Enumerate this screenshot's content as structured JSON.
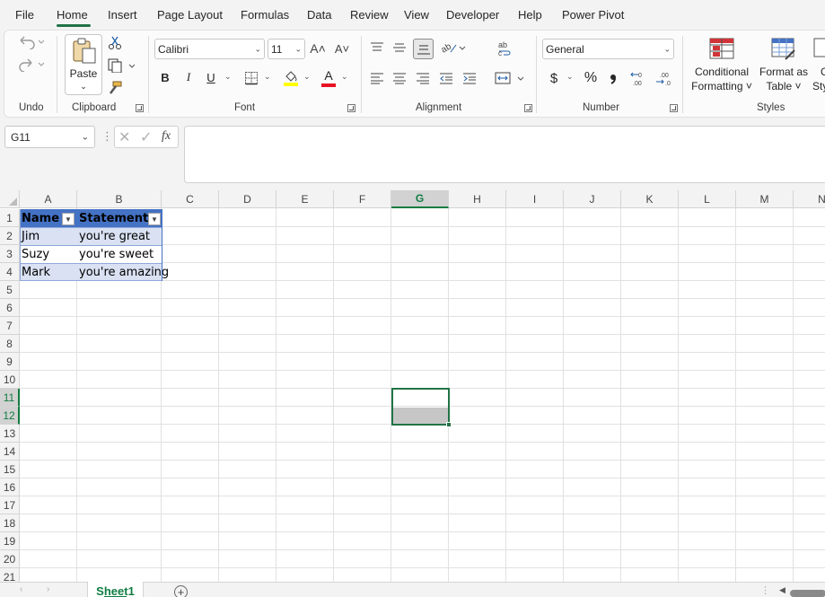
{
  "menu": {
    "tabs": [
      "File",
      "Home",
      "Insert",
      "Page Layout",
      "Formulas",
      "Data",
      "Review",
      "View",
      "Developer",
      "Help",
      "Power Pivot"
    ],
    "active": "Home"
  },
  "ribbon": {
    "groups": {
      "undo": "Undo",
      "clipboard": "Clipboard",
      "font": "Font",
      "alignment": "Alignment",
      "number": "Number",
      "styles": "Styles"
    },
    "paste_label": "Paste",
    "font_name": "Calibri",
    "font_size": "11",
    "grow_font": "A˄",
    "shrink_font": "A˅",
    "bold": "B",
    "italic": "I",
    "underline": "U",
    "font_color_glyph": "A",
    "number_format": "General",
    "currency": "$",
    "percent": "%",
    "comma": "9",
    "conditional_formatting": [
      "Conditional",
      "Formatting ˅"
    ],
    "format_as_table": [
      "Format as",
      "Table ˅"
    ],
    "cell_styles_partial": [
      "C",
      "Sty"
    ],
    "colors": {
      "fill_swatch": "#ffff00",
      "font_swatch": "#e81123",
      "accent": "#217346"
    }
  },
  "formula_bar": {
    "name_box": "G11",
    "fx": "fx",
    "content": ""
  },
  "sheet": {
    "columns": [
      "A",
      "B",
      "C",
      "D",
      "E",
      "F",
      "G",
      "H",
      "I",
      "J",
      "K",
      "L",
      "M",
      "N"
    ],
    "rows": [
      "1",
      "2",
      "3",
      "4",
      "5",
      "6",
      "7",
      "8",
      "9",
      "10",
      "11",
      "12",
      "13",
      "14",
      "15",
      "16",
      "17",
      "18",
      "19",
      "20",
      "21"
    ],
    "selected_column": "G",
    "selected_rows": [
      "11",
      "12"
    ],
    "table": {
      "headers": [
        "Name",
        "Statement"
      ],
      "rows": [
        [
          "Jim",
          "you're great"
        ],
        [
          "Suzy",
          "you're sweet"
        ],
        [
          "Mark",
          "you're amazing"
        ]
      ],
      "colors": {
        "header": "#4472c4",
        "band": "#d9e1f2"
      }
    }
  },
  "sheet_tabs": {
    "tabs": [
      "Sheet1"
    ],
    "add_glyph": "+"
  }
}
